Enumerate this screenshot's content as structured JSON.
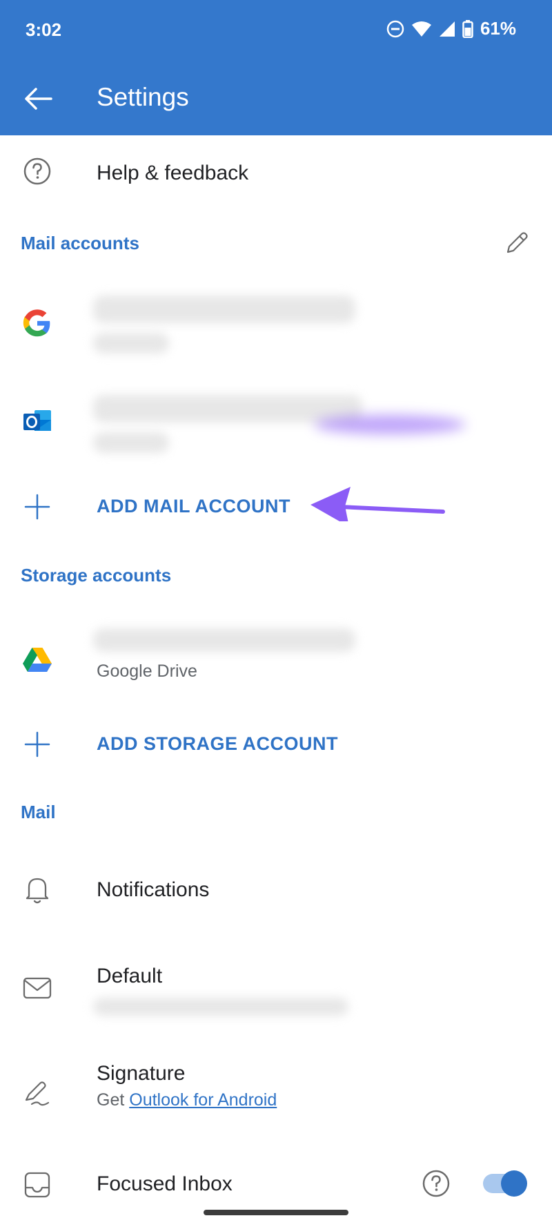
{
  "status_bar": {
    "time": "3:02",
    "battery": "61%"
  },
  "header": {
    "title": "Settings",
    "back_icon": "arrow-left-icon"
  },
  "help": {
    "label": "Help & feedback",
    "icon": "help-circle-icon"
  },
  "mail_accounts": {
    "heading": "Mail accounts",
    "edit_icon": "pencil-icon",
    "accounts": [
      {
        "provider": "google",
        "icon": "google-icon"
      },
      {
        "provider": "outlook",
        "icon": "outlook-icon"
      }
    ],
    "add_label": "ADD MAIL ACCOUNT"
  },
  "storage_accounts": {
    "heading": "Storage accounts",
    "accounts": [
      {
        "subtitle": "Google Drive",
        "icon": "google-drive-icon"
      }
    ],
    "add_label": "ADD STORAGE ACCOUNT"
  },
  "mail": {
    "heading": "Mail",
    "items": [
      {
        "label": "Notifications",
        "icon": "bell-icon"
      },
      {
        "label": "Default",
        "icon": "envelope-icon"
      },
      {
        "label": "Signature",
        "icon": "signature-icon",
        "sub_prefix": "Get ",
        "sub_link": "Outlook for Android"
      },
      {
        "label": "Focused Inbox",
        "icon": "inbox-icon",
        "toggle_on": true
      }
    ]
  },
  "colors": {
    "accent": "#3478cc",
    "link": "#2f73c6",
    "annotation_arrow": "#8b5cf6"
  }
}
